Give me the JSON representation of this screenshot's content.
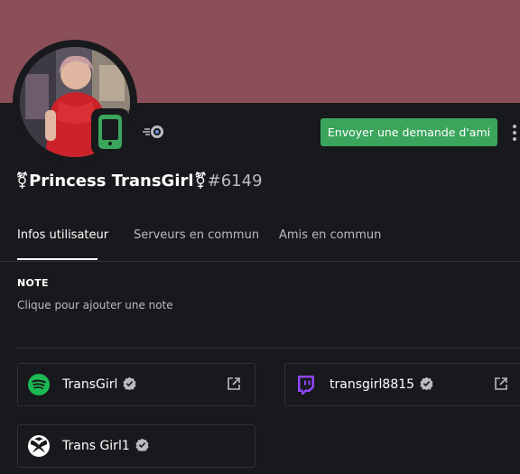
{
  "profile": {
    "display_name": "⚧Princess TransGirl⚧",
    "discriminator": "#6149",
    "status": "mobile-online",
    "banner_color": "#8a4f59"
  },
  "actions": {
    "friend_request_label": "Envoyer une demande d'ami"
  },
  "tabs": [
    {
      "label": "Infos utilisateur",
      "active": true
    },
    {
      "label": "Serveurs en commun",
      "active": false
    },
    {
      "label": "Amis en commun",
      "active": false
    }
  ],
  "note": {
    "title": "NOTE",
    "placeholder": "Clique pour ajouter une note"
  },
  "connections": [
    {
      "service": "spotify",
      "icon": "spotify-icon",
      "name": "TransGirl",
      "verified": true
    },
    {
      "service": "twitch",
      "icon": "twitch-icon",
      "name": "transgirl8815",
      "verified": true
    },
    {
      "service": "xbox",
      "icon": "xbox-icon",
      "name": "Trans Girl1",
      "verified": true
    }
  ],
  "colors": {
    "accent_green": "#3ba55c",
    "spotify": "#1db954",
    "twitch": "#9146ff",
    "background": "#18191c"
  }
}
